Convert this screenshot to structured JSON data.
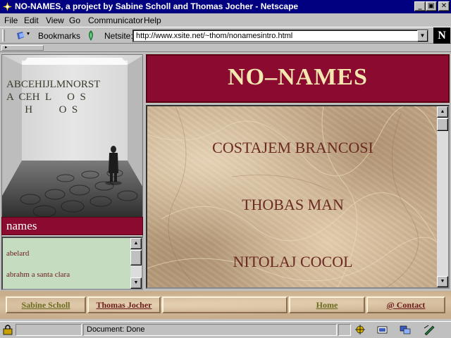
{
  "window": {
    "title": "NO-NAMES, a project by Sabine Scholl and Thomas Jocher - Netscape",
    "buttons": {
      "minimize": "_",
      "maximize": "▣",
      "close": "✕"
    }
  },
  "menu": [
    "File",
    "Edit",
    "View",
    "Go",
    "Communicator",
    "Help"
  ],
  "location_bar": {
    "bookmarks_label": "Bookmarks",
    "netsite_label": "Netsite:",
    "url": "http://www.xsite.net/~thom/nonamesintro.html",
    "logo_letter": "N"
  },
  "sidebar": {
    "picture_letters": [
      "ABCEHIJLMNORST",
      "A  CEH  L      O  S",
      "       H          O  S"
    ],
    "names_heading": "names",
    "names": [
      "abelard",
      "abrahm a santa clara"
    ]
  },
  "banner": {
    "title": "NO–NAMES"
  },
  "main": {
    "entries": [
      "COSTAJEM BRANCOSI",
      "THOBAS MAN",
      "NITOLAJ COCOL"
    ]
  },
  "footer": {
    "links": [
      "Sabine Scholl",
      "Thomas Jocher",
      "",
      "Home",
      "@ Contact"
    ],
    "link_colors": [
      "#6b6b20",
      "#6b1a1a",
      "#6b6b20",
      "#6b6b20",
      "#6b1a1a"
    ]
  },
  "status": {
    "text": "Document: Done"
  },
  "icons": [
    "netscape-app-icon",
    "bookmarks-icon",
    "netsite-icon",
    "security-lock-icon",
    "component-bar-icons"
  ]
}
